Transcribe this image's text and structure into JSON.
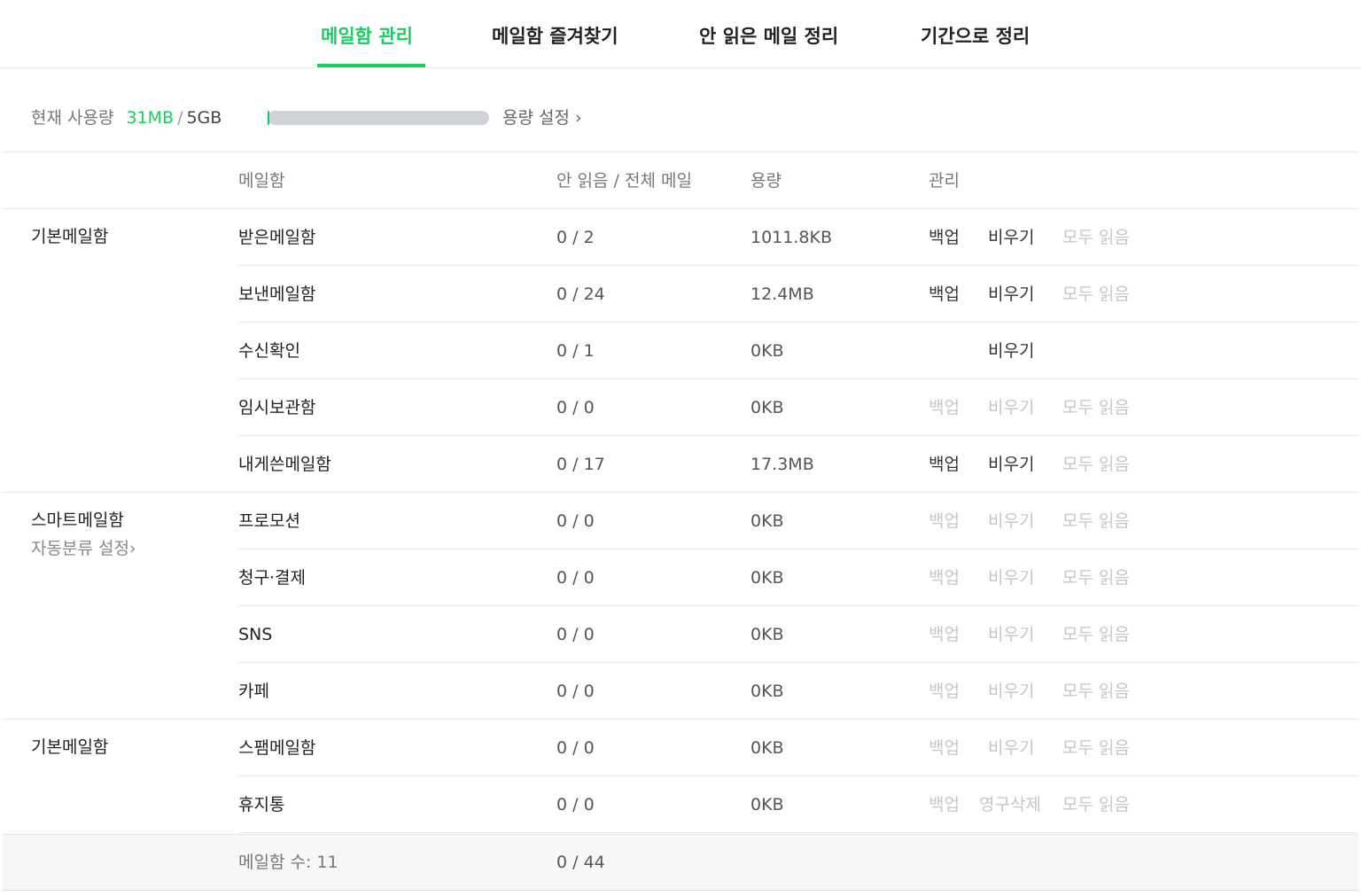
{
  "tabs": [
    {
      "label": "메일함 관리",
      "active": true
    },
    {
      "label": "메일함 즐겨찾기",
      "active": false
    },
    {
      "label": "안 읽은 메일 정리",
      "active": false
    },
    {
      "label": "기간으로 정리",
      "active": false
    }
  ],
  "usage": {
    "label": "현재 사용량",
    "used": "31MB",
    "separator": "/",
    "total": "5GB",
    "settings_link": "용량 설정 ›",
    "used_fraction": 0.006
  },
  "table": {
    "headers": {
      "mailbox": "메일함",
      "count": "안 읽음 / 전체 메일",
      "size": "용량",
      "manage": "관리"
    },
    "groups": [
      {
        "label": "기본메일함",
        "sub": ""
      },
      {
        "label": "스마트메일함",
        "sub": "자동분류 설정›"
      },
      {
        "label": "기본메일함",
        "sub": ""
      }
    ],
    "rows": [
      {
        "name": "받은메일함",
        "count": "0 / 2",
        "size": "1011.8KB",
        "actions": [
          {
            "label": "백업",
            "enabled": true
          },
          {
            "label": "비우기",
            "enabled": true
          },
          {
            "label": "모두 읽음",
            "enabled": false
          }
        ]
      },
      {
        "name": "보낸메일함",
        "count": "0 / 24",
        "size": "12.4MB",
        "actions": [
          {
            "label": "백업",
            "enabled": true
          },
          {
            "label": "비우기",
            "enabled": true
          },
          {
            "label": "모두 읽음",
            "enabled": false
          }
        ]
      },
      {
        "name": "수신확인",
        "count": "0 / 1",
        "size": "0KB",
        "actions": [
          {
            "label": "비우기",
            "enabled": true
          }
        ]
      },
      {
        "name": "임시보관함",
        "count": "0 / 0",
        "size": "0KB",
        "actions": [
          {
            "label": "백업",
            "enabled": false
          },
          {
            "label": "비우기",
            "enabled": false
          },
          {
            "label": "모두 읽음",
            "enabled": false
          }
        ]
      },
      {
        "name": "내게쓴메일함",
        "count": "0 / 17",
        "size": "17.3MB",
        "actions": [
          {
            "label": "백업",
            "enabled": true
          },
          {
            "label": "비우기",
            "enabled": true
          },
          {
            "label": "모두 읽음",
            "enabled": false
          }
        ]
      },
      {
        "name": "프로모션",
        "count": "0 / 0",
        "size": "0KB",
        "actions": [
          {
            "label": "백업",
            "enabled": false
          },
          {
            "label": "비우기",
            "enabled": false
          },
          {
            "label": "모두 읽음",
            "enabled": false
          }
        ]
      },
      {
        "name": "청구·결제",
        "count": "0 / 0",
        "size": "0KB",
        "actions": [
          {
            "label": "백업",
            "enabled": false
          },
          {
            "label": "비우기",
            "enabled": false
          },
          {
            "label": "모두 읽음",
            "enabled": false
          }
        ]
      },
      {
        "name": "SNS",
        "count": "0 / 0",
        "size": "0KB",
        "actions": [
          {
            "label": "백업",
            "enabled": false
          },
          {
            "label": "비우기",
            "enabled": false
          },
          {
            "label": "모두 읽음",
            "enabled": false
          }
        ]
      },
      {
        "name": "카페",
        "count": "0 / 0",
        "size": "0KB",
        "actions": [
          {
            "label": "백업",
            "enabled": false
          },
          {
            "label": "비우기",
            "enabled": false
          },
          {
            "label": "모두 읽음",
            "enabled": false
          }
        ]
      },
      {
        "name": "스팸메일함",
        "count": "0 / 0",
        "size": "0KB",
        "actions": [
          {
            "label": "백업",
            "enabled": false
          },
          {
            "label": "비우기",
            "enabled": false
          },
          {
            "label": "모두 읽음",
            "enabled": false
          }
        ]
      },
      {
        "name": "휴지통",
        "count": "0 / 0",
        "size": "0KB",
        "actions": [
          {
            "label": "백업",
            "enabled": false
          },
          {
            "label": "영구삭제",
            "enabled": false
          },
          {
            "label": "모두 읽음",
            "enabled": false
          }
        ]
      }
    ],
    "footer": {
      "mailbox_count": "메일함 수: 11",
      "total": "0 / 44"
    }
  },
  "colors": {
    "accent": "#19ce60",
    "bar_track": "#cfd2d8",
    "disabled": "#c6c6c6"
  }
}
